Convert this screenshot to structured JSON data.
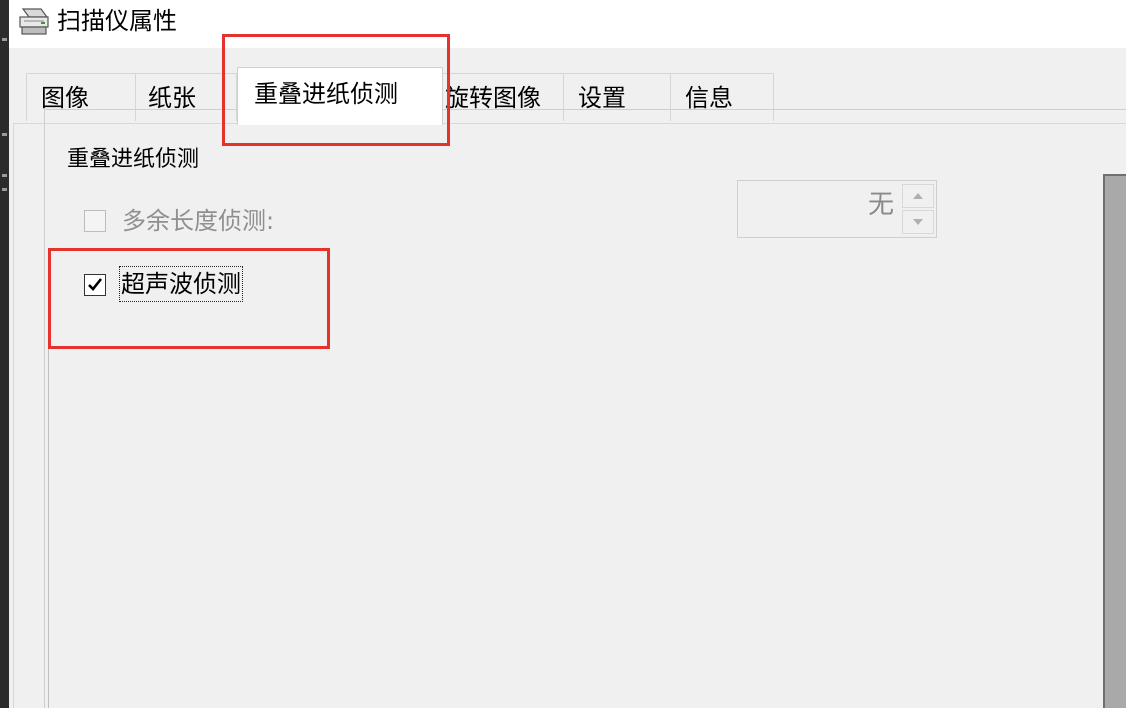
{
  "window": {
    "title": "扫描仪属性",
    "icon": "scanner-icon"
  },
  "tabs": [
    {
      "label": "图像",
      "active": false
    },
    {
      "label": "纸张",
      "active": false
    },
    {
      "label": "重叠进纸侦测",
      "active": true
    },
    {
      "label": "旋转图像",
      "active": false
    },
    {
      "label": "设置",
      "active": false
    },
    {
      "label": "信息",
      "active": false
    }
  ],
  "group": {
    "title": "重叠进纸侦测",
    "excess_length": {
      "label": "多余长度侦测:",
      "checked": false,
      "enabled": false
    },
    "ultrasonic": {
      "label": "超声波侦测",
      "checked": true,
      "enabled": true
    },
    "length_spinner": {
      "value": "无",
      "enabled": false
    }
  },
  "annotations": {
    "color": "#e6322d"
  }
}
